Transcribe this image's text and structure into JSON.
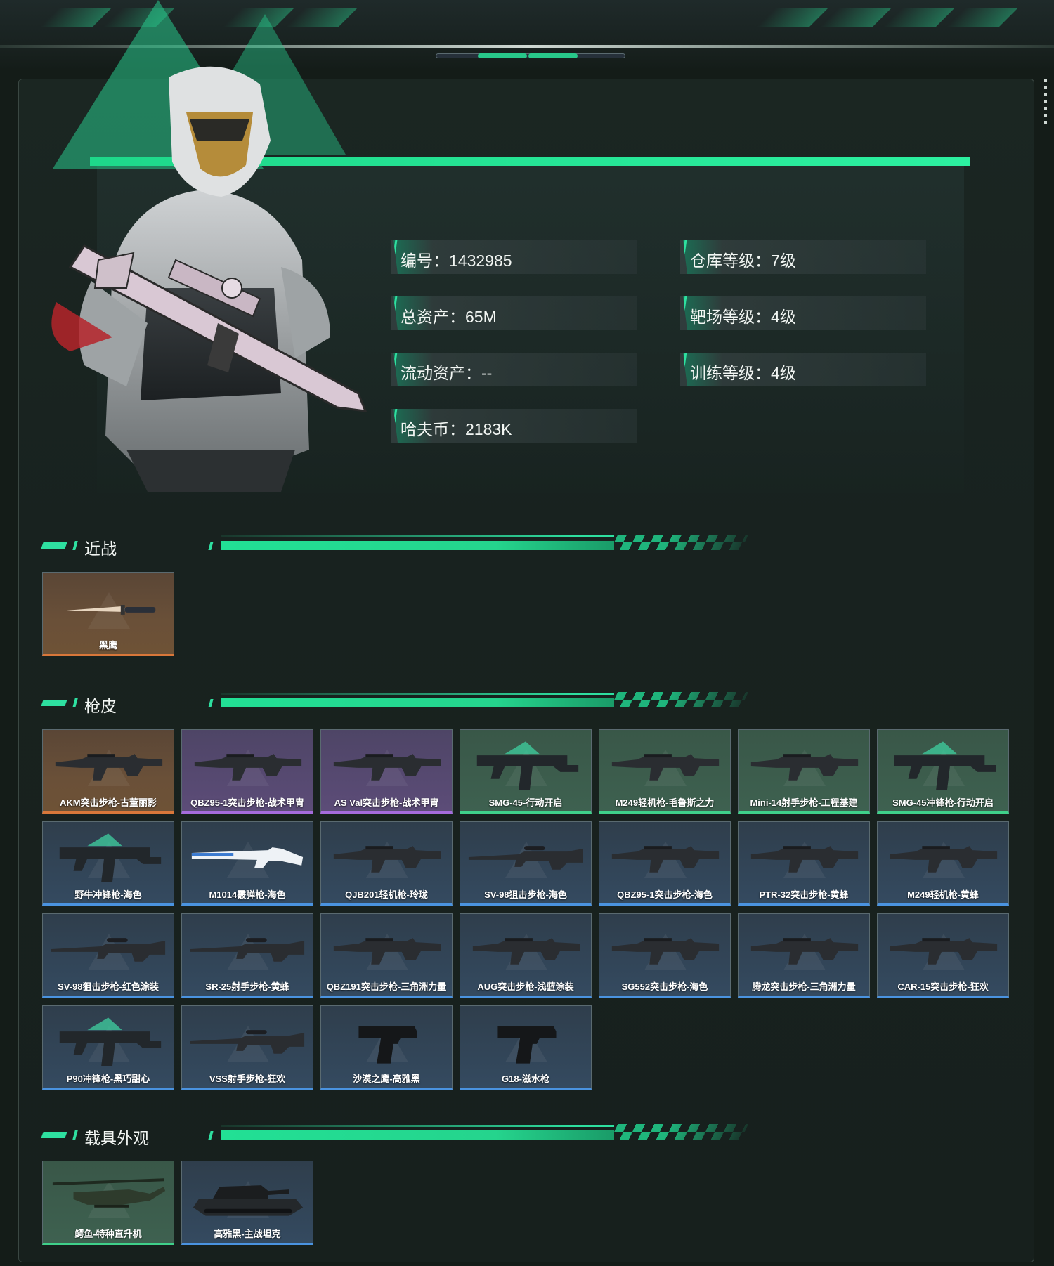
{
  "profile": {
    "fields_left": [
      {
        "label": "编号：1432985"
      },
      {
        "label": "总资产：65M"
      },
      {
        "label": "流动资产：--"
      },
      {
        "label": "哈夫币：2183K"
      }
    ],
    "fields_right": [
      {
        "label": "仓库等级：7级"
      },
      {
        "label": "靶场等级：4级"
      },
      {
        "label": "训练等级：4级"
      }
    ]
  },
  "sections": {
    "melee": {
      "title": "近战",
      "items": [
        {
          "name": "黑鹰",
          "rarity": "orange",
          "icon": "knife-icon"
        }
      ]
    },
    "skins": {
      "title": "枪皮",
      "items": [
        {
          "name": "AKM突击步枪-古董丽影",
          "rarity": "orange",
          "icon": "rifle-icon"
        },
        {
          "name": "QBZ95-1突击步枪-战术甲胄",
          "rarity": "purple",
          "icon": "rifle-icon"
        },
        {
          "name": "AS Val突击步枪-战术甲胄",
          "rarity": "purple",
          "icon": "rifle-icon"
        },
        {
          "name": "SMG-45-行动开启",
          "rarity": "green",
          "icon": "smg-icon"
        },
        {
          "name": "M249轻机枪-毛鲁斯之力",
          "rarity": "green",
          "icon": "rifle-icon"
        },
        {
          "name": "Mini-14射手步枪-工程基建",
          "rarity": "green",
          "icon": "rifle-icon"
        },
        {
          "name": "SMG-45冲锋枪-行动开启",
          "rarity": "green",
          "icon": "smg-icon"
        },
        {
          "name": "野牛冲锋枪-海色",
          "rarity": "blue",
          "icon": "smg-icon"
        },
        {
          "name": "M1014霰弹枪-海色",
          "rarity": "blue",
          "icon": "shotgun-icon"
        },
        {
          "name": "QJB201轻机枪-玲珑",
          "rarity": "blue",
          "icon": "rifle-icon"
        },
        {
          "name": "SV-98狙击步枪-海色",
          "rarity": "blue",
          "icon": "sniper-icon"
        },
        {
          "name": "QBZ95-1突击步枪-海色",
          "rarity": "blue",
          "icon": "rifle-icon"
        },
        {
          "name": "PTR-32突击步枪-黄蜂",
          "rarity": "blue",
          "icon": "rifle-icon"
        },
        {
          "name": "M249轻机枪-黄蜂",
          "rarity": "blue",
          "icon": "rifle-icon"
        },
        {
          "name": "SV-98狙击步枪-红色涂装",
          "rarity": "blue",
          "icon": "sniper-icon"
        },
        {
          "name": "SR-25射手步枪-黄蜂",
          "rarity": "blue",
          "icon": "sniper-icon"
        },
        {
          "name": "QBZ191突击步枪-三角洲力量",
          "rarity": "blue",
          "icon": "rifle-icon"
        },
        {
          "name": "AUG突击步枪-浅蓝涂装",
          "rarity": "blue",
          "icon": "rifle-icon"
        },
        {
          "name": "SG552突击步枪-海色",
          "rarity": "blue",
          "icon": "rifle-icon"
        },
        {
          "name": "腾龙突击步枪-三角洲力量",
          "rarity": "blue",
          "icon": "rifle-icon"
        },
        {
          "name": "CAR-15突击步枪-狂欢",
          "rarity": "blue",
          "icon": "rifle-icon"
        },
        {
          "name": "P90冲锋枪-黑巧甜心",
          "rarity": "blue",
          "icon": "smg-icon"
        },
        {
          "name": "VSS射手步枪-狂欢",
          "rarity": "blue",
          "icon": "sniper-icon"
        },
        {
          "name": "沙漠之鹰-高雅黑",
          "rarity": "blue",
          "icon": "pistol-icon"
        },
        {
          "name": "G18-滋水枪",
          "rarity": "blue",
          "icon": "pistol-icon"
        }
      ]
    },
    "vehicles": {
      "title": "载具外观",
      "items": [
        {
          "name": "鳄鱼-特种直升机",
          "rarity": "green",
          "icon": "helicopter-icon"
        },
        {
          "name": "高雅黑-主战坦克",
          "rarity": "blue",
          "icon": "tank-icon"
        }
      ]
    }
  },
  "colors": {
    "accent": "#2ee0a0",
    "rarity_orange": "#d8773a",
    "rarity_purple": "#a56bdc",
    "rarity_green": "#3fd08a",
    "rarity_blue": "#4a93e0"
  }
}
